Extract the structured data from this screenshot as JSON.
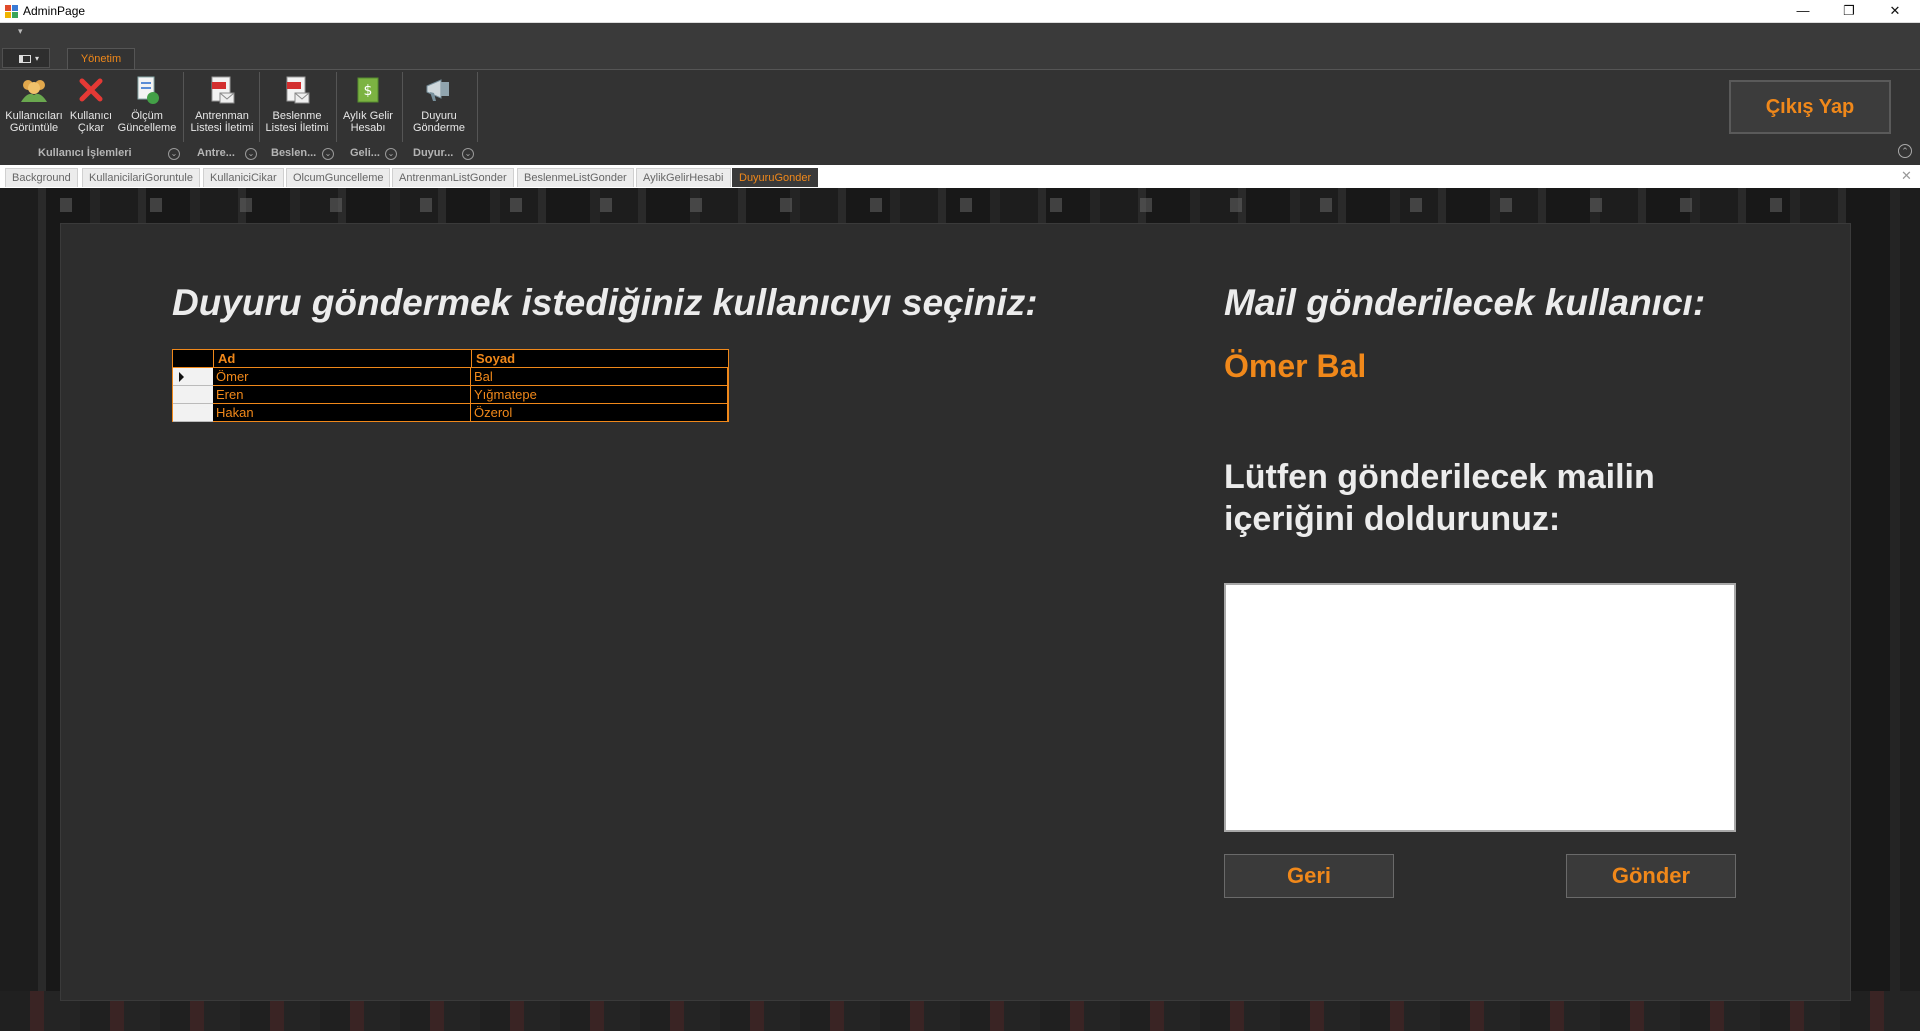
{
  "window": {
    "title": "AdminPage",
    "controls": [
      "—",
      "❐",
      "✕"
    ]
  },
  "ribbon": {
    "qat_glyph": "▾",
    "menu_caret": "▾",
    "tab": "Yönetim",
    "buttons": [
      {
        "line1": "Kullanıcıları",
        "line2": "Görüntüle",
        "icon": "users-icon"
      },
      {
        "line1": "Kullanıcı",
        "line2": "Çıkar",
        "icon": "remove-user-icon"
      },
      {
        "line1": "Ölçüm",
        "line2": "Güncelleme",
        "icon": "measurement-update-icon"
      },
      {
        "line1": "Antrenman",
        "line2": "Listesi İletimi",
        "icon": "pdf-mail-icon"
      },
      {
        "line1": "Beslenme",
        "line2": "Listesi İletimi",
        "icon": "pdf-mail-icon"
      },
      {
        "line1": "Aylık Gelir",
        "line2": "Hesabı",
        "icon": "money-icon"
      },
      {
        "line1": "Duyuru",
        "line2": "Gönderme",
        "icon": "megaphone-icon"
      }
    ],
    "groups": [
      "Kullanıcı İşlemleri",
      "Antre...",
      "Beslen...",
      "Geli...",
      "Duyur..."
    ],
    "group_button_glyph": "⌄",
    "logout": "Çıkış Yap",
    "collapse_glyph": "⌃"
  },
  "doc_tabs": [
    "Background",
    "KullanicilariGoruntule",
    "KullaniciCikar",
    "OlcumGuncelleme",
    "AntrenmanListGonder",
    "BeslenmeListGonder",
    "AylikGelirHesabi",
    "DuyuruGonder"
  ],
  "doc_close": "✕",
  "left": {
    "heading": "Duyuru göndermek istediğiniz kullanıcıyı seçiniz:",
    "columns": [
      "Ad",
      "Soyad"
    ],
    "rows": [
      {
        "ad": "Ömer",
        "soyad": "Bal"
      },
      {
        "ad": "Eren",
        "soyad": "Yığmatepe"
      },
      {
        "ad": "Hakan",
        "soyad": "Özerol"
      }
    ]
  },
  "right": {
    "heading": "Mail gönderilecek kullanıcı:",
    "selected_user": "Ömer Bal",
    "prompt": "Lütfen gönderilecek mailin içeriğini doldurunuz:",
    "mail_body": "",
    "back_button": "Geri",
    "send_button": "Gönder"
  },
  "colors": {
    "accent": "#f0881a",
    "panel": "#2d2d2d",
    "ribbon": "#333333"
  }
}
